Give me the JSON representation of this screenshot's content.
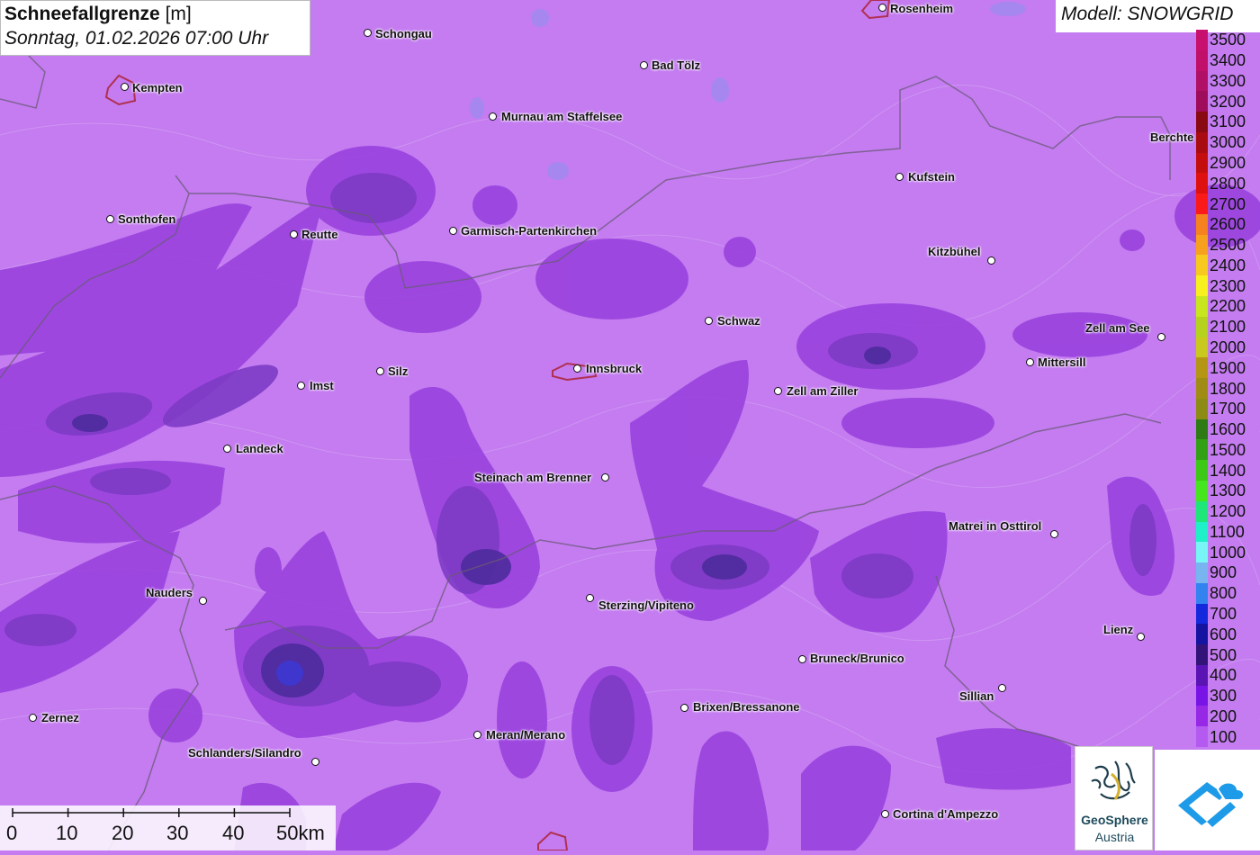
{
  "title": {
    "main_bold": "Schneefallgrenze",
    "main_unit": "[m]",
    "subtitle": "Sonntag, 01.02.2026 07:00 Uhr"
  },
  "model_label": "Modell: SNOWGRID",
  "cities": [
    {
      "name": "Schongau",
      "id": "schongau"
    },
    {
      "name": "Rosenheim",
      "id": "rosenheim"
    },
    {
      "name": "Kempten",
      "id": "kempten"
    },
    {
      "name": "Bad Tölz",
      "id": "bad-toelz"
    },
    {
      "name": "Murnau am Staffelsee",
      "id": "murnau"
    },
    {
      "name": "Berchte",
      "id": "berchtesgaden"
    },
    {
      "name": "Kufstein",
      "id": "kufstein"
    },
    {
      "name": "Sonthofen",
      "id": "sonthofen"
    },
    {
      "name": "Reutte",
      "id": "reutte"
    },
    {
      "name": "Garmisch-Partenkirchen",
      "id": "garmisch"
    },
    {
      "name": "Kitzbühel",
      "id": "kitzbuehel"
    },
    {
      "name": "Schwaz",
      "id": "schwaz"
    },
    {
      "name": "Zell am See",
      "id": "zell-am-see"
    },
    {
      "name": "Mittersill",
      "id": "mittersill"
    },
    {
      "name": "Silz",
      "id": "silz"
    },
    {
      "name": "Innsbruck",
      "id": "innsbruck"
    },
    {
      "name": "Imst",
      "id": "imst"
    },
    {
      "name": "Zell am Ziller",
      "id": "zell-am-ziller"
    },
    {
      "name": "Landeck",
      "id": "landeck"
    },
    {
      "name": "Steinach am Brenner",
      "id": "steinach"
    },
    {
      "name": "Matrei in Osttirol",
      "id": "matrei"
    },
    {
      "name": "Nauders",
      "id": "nauders"
    },
    {
      "name": "Sterzing/Vipiteno",
      "id": "sterzing"
    },
    {
      "name": "Lienz",
      "id": "lienz"
    },
    {
      "name": "Bruneck/Brunico",
      "id": "bruneck"
    },
    {
      "name": "Sillian",
      "id": "sillian"
    },
    {
      "name": "Brixen/Bressanone",
      "id": "brixen"
    },
    {
      "name": "Zernez",
      "id": "zernez"
    },
    {
      "name": "Meran/Merano",
      "id": "meran"
    },
    {
      "name": "Schlanders/Silandro",
      "id": "schlanders"
    },
    {
      "name": "Cortina d'Ampezzo",
      "id": "cortina"
    }
  ],
  "legend": {
    "levels": [
      {
        "label": "3500",
        "color": "#c8106e"
      },
      {
        "label": "3400",
        "color": "#c0106a"
      },
      {
        "label": "3300",
        "color": "#b01066"
      },
      {
        "label": "3200",
        "color": "#a00c5c"
      },
      {
        "label": "3100",
        "color": "#8a0a14"
      },
      {
        "label": "3000",
        "color": "#a80c10"
      },
      {
        "label": "2900",
        "color": "#c40e0e"
      },
      {
        "label": "2800",
        "color": "#de1010"
      },
      {
        "label": "2700",
        "color": "#fa1a1a"
      },
      {
        "label": "2600",
        "color": "#f5821e"
      },
      {
        "label": "2500",
        "color": "#f7a01e"
      },
      {
        "label": "2400",
        "color": "#f7c81e"
      },
      {
        "label": "2300",
        "color": "#f7f01e"
      },
      {
        "label": "2200",
        "color": "#c8e61e"
      },
      {
        "label": "2100",
        "color": "#b4d21e"
      },
      {
        "label": "2000",
        "color": "#c8c81e"
      },
      {
        "label": "1900",
        "color": "#b49614"
      },
      {
        "label": "1800",
        "color": "#a08c14"
      },
      {
        "label": "1700",
        "color": "#8c8c14"
      },
      {
        "label": "1600",
        "color": "#2e7a14"
      },
      {
        "label": "1500",
        "color": "#32a014"
      },
      {
        "label": "1400",
        "color": "#3cc814"
      },
      {
        "label": "1300",
        "color": "#46e61e"
      },
      {
        "label": "1200",
        "color": "#1ee678"
      },
      {
        "label": "1100",
        "color": "#1ef0c8"
      },
      {
        "label": "1000",
        "color": "#78f5f5"
      },
      {
        "label": "900",
        "color": "#78b4f0"
      },
      {
        "label": "800",
        "color": "#3282f0"
      },
      {
        "label": "700",
        "color": "#1428dc"
      },
      {
        "label": "600",
        "color": "#1414a0"
      },
      {
        "label": "500",
        "color": "#321478"
      },
      {
        "label": "400",
        "color": "#5a14b4"
      },
      {
        "label": "300",
        "color": "#7814e6"
      },
      {
        "label": "200",
        "color": "#9628e6"
      },
      {
        "label": "100",
        "color": "#b45af0"
      }
    ]
  },
  "scale_bar": {
    "labels": [
      "0",
      "10",
      "20",
      "30",
      "40",
      "50km"
    ]
  },
  "logos": {
    "geosphere_line1": "GeoSphere",
    "geosphere_line2": "Austria"
  },
  "colors": {
    "background": "#c47cf0",
    "band_300": "#9b45df",
    "band_500": "#7d3ac4",
    "band_700": "#4a2a9a"
  }
}
